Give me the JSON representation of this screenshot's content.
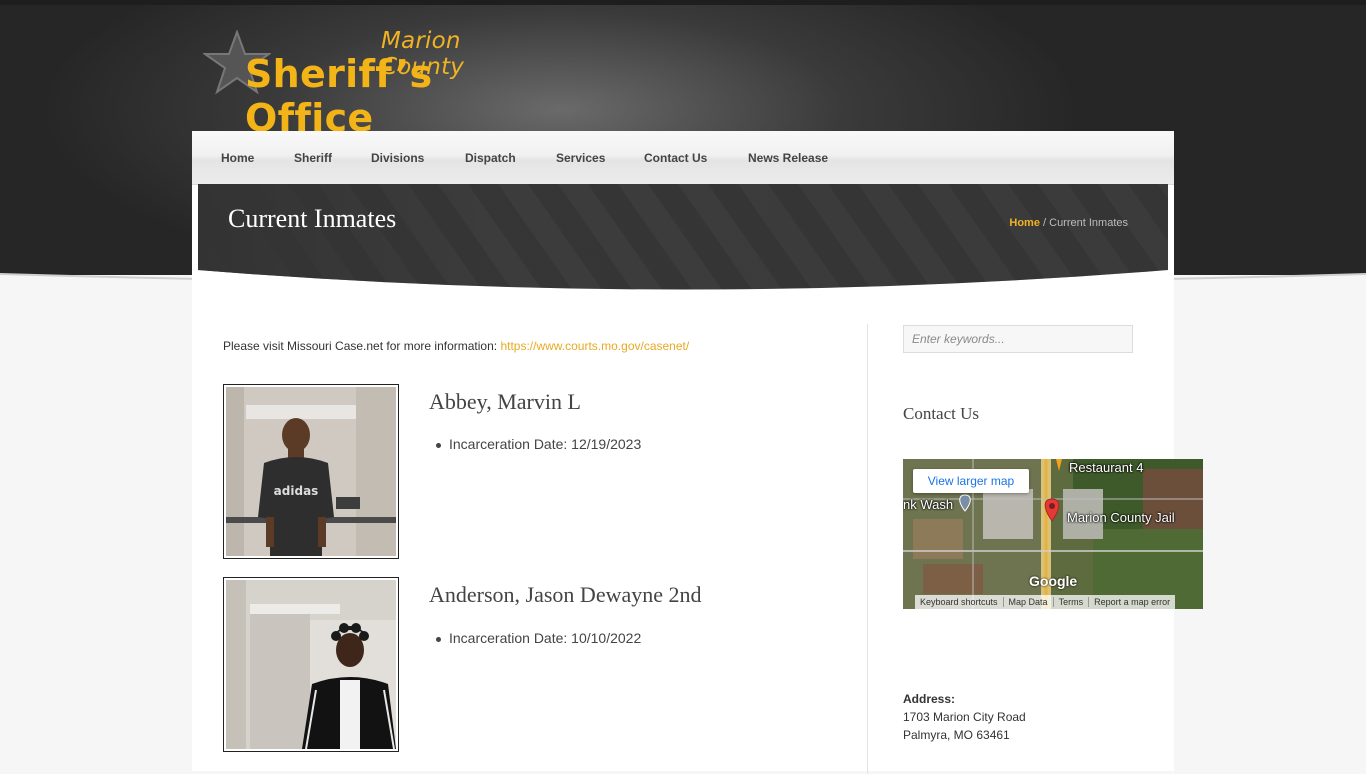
{
  "brand": {
    "county": "Marion County",
    "office": "Sheriff’s Office"
  },
  "nav": {
    "items": [
      "Home",
      "Sheriff",
      "Divisions",
      "Dispatch",
      "Services",
      "Contact Us",
      "News Release"
    ]
  },
  "page": {
    "title": "Current Inmates",
    "breadcrumb_home": "Home",
    "breadcrumb_sep": " / ",
    "breadcrumb_current": "Current Inmates"
  },
  "intro": {
    "text": "Please visit Missouri Case.net for more information: ",
    "link": "https://www.courts.mo.gov/casenet/"
  },
  "inmates": [
    {
      "name": "Abbey, Marvin L",
      "detail": "Incarceration Date: 12/19/2023",
      "shirt_text": "adidas"
    },
    {
      "name": "Anderson, Jason Dewayne 2nd",
      "detail": "Incarceration Date: 10/10/2022"
    }
  ],
  "sidebar": {
    "search_placeholder": "Enter keywords...",
    "contact_heading": "Contact Us",
    "map": {
      "button": "View larger map",
      "labels": [
        "Restaurant 4",
        "nk Wash",
        "Marion County Jail"
      ],
      "logo": "Google",
      "footer": [
        "Keyboard shortcuts",
        "Map Data",
        "Terms",
        "Report a map error"
      ]
    },
    "address_label": "Address:",
    "address_lines": [
      "1703 Marion City Road",
      "Palmyra, MO 63461"
    ]
  },
  "colors": {
    "accent": "#f0b323",
    "link": "#e9a922",
    "header_dark": "#262626",
    "banner_dark": "#3c3c3c"
  }
}
